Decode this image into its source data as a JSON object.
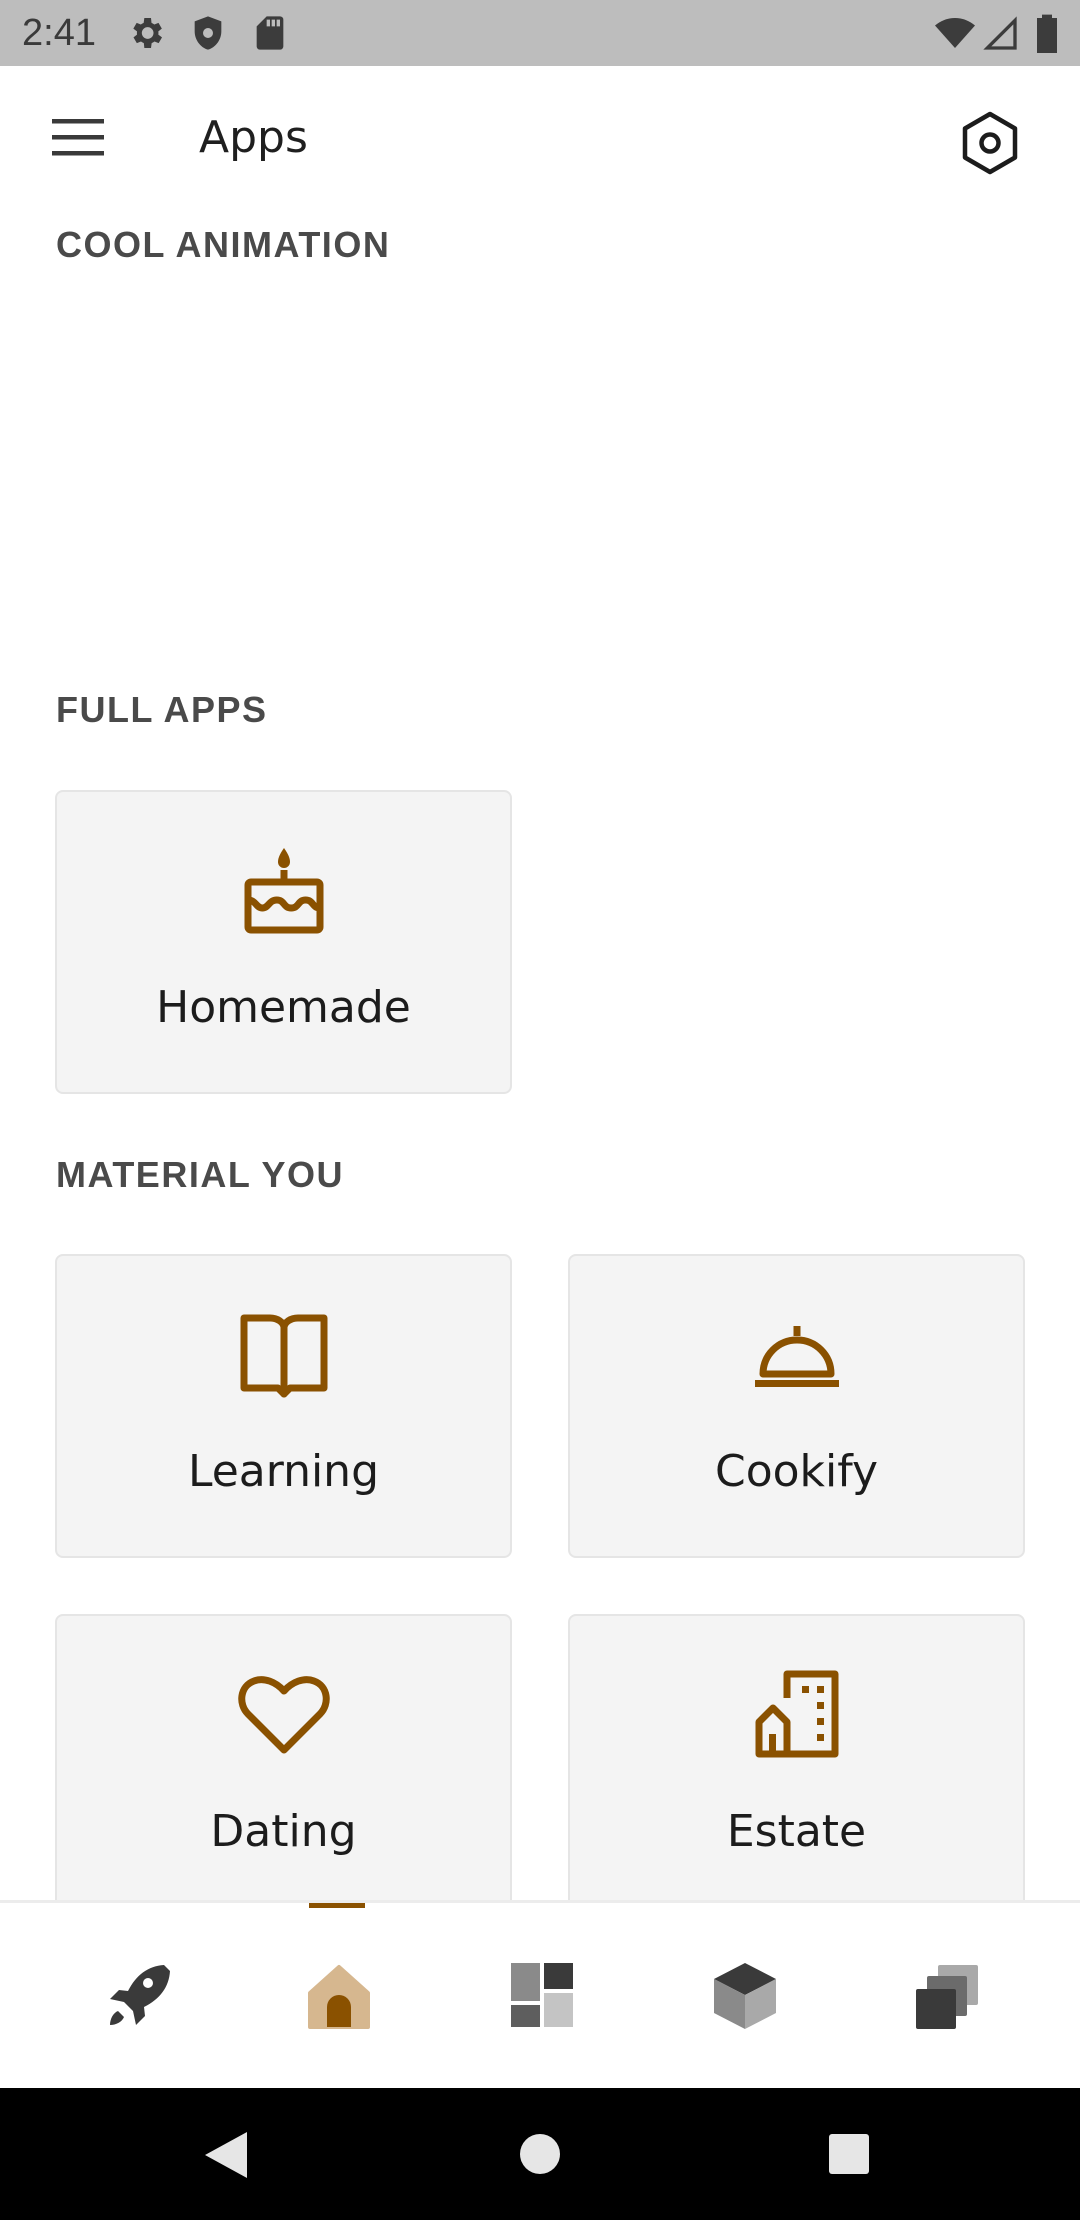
{
  "status_bar": {
    "time": "2:41",
    "left_icons": [
      "gear-icon",
      "shield-icon",
      "sd-card-icon"
    ],
    "right_icons": [
      "wifi-icon",
      "signal-icon",
      "battery-icon"
    ]
  },
  "top_bar": {
    "title": "Apps",
    "menu_icon": "hamburger-menu-icon",
    "settings_icon": "hexagon-settings-icon"
  },
  "sections": {
    "cool_animation": "COOL ANIMATION",
    "full_apps": "FULL APPS",
    "material_you": "MATERIAL YOU"
  },
  "full_apps": [
    {
      "label": "Homemade",
      "icon": "cake-icon"
    }
  ],
  "material_you": [
    {
      "label": "Learning",
      "icon": "book-icon"
    },
    {
      "label": "Cookify",
      "icon": "cloche-icon"
    },
    {
      "label": "Dating",
      "icon": "heart-icon"
    },
    {
      "label": "Estate",
      "icon": "building-icon"
    }
  ],
  "bottom_nav": {
    "items": [
      "rocket-icon",
      "home-icon",
      "dashboard-icon",
      "cube-icon",
      "layers-icon"
    ],
    "selected": "home-icon"
  },
  "colors": {
    "accent": "#8a5100",
    "accent_light": "#d6b78f",
    "card_background": "#f4f4f4",
    "status_bar": "#bdbdbd"
  }
}
